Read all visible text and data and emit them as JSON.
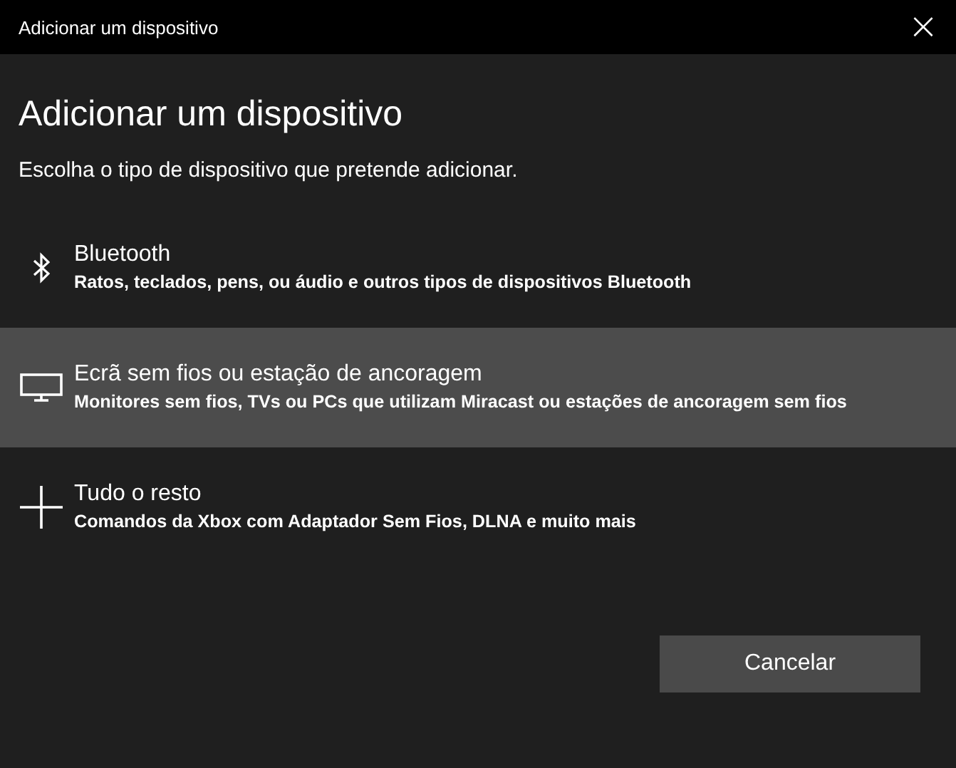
{
  "window": {
    "title": "Adicionar um dispositivo",
    "close": "×"
  },
  "heading": "Adicionar um dispositivo",
  "instruction": "Escolha o tipo de dispositivo que pretende adicionar.",
  "options": [
    {
      "kind": "bluetooth",
      "title": "Bluetooth",
      "description": "Ratos, teclados, pens, ou áudio e outros tipos de dispositivos Bluetooth",
      "selected": false
    },
    {
      "kind": "display",
      "title": "Ecrã sem fios ou estação de ancoragem",
      "description": "Monitores sem fios, TVs ou PCs que utilizam Miracast ou estações de ancoragem sem fios",
      "selected": true
    },
    {
      "kind": "other",
      "title": "Tudo o resto",
      "description": "Comandos da Xbox com Adaptador Sem Fios, DLNA e muito mais",
      "selected": false
    }
  ],
  "buttons": [
    "Cancelar"
  ]
}
